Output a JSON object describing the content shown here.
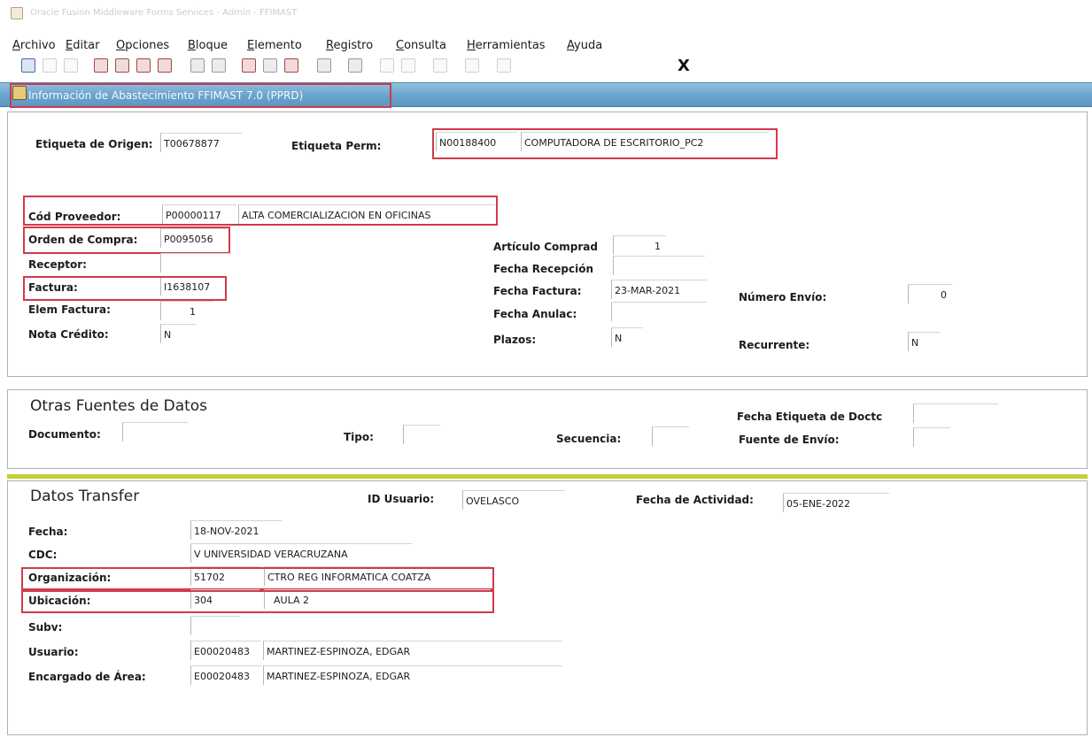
{
  "app_title": "Oracle Fusion Middleware Forms Services - Admin - FFIMAST",
  "menu": [
    "Archivo",
    "Editar",
    "Opciones",
    "Bloque",
    "Elemento",
    "Registro",
    "Consulta",
    "Herramientas",
    "Ayuda"
  ],
  "toolbar": {
    "exit_label": "X"
  },
  "header": {
    "title": "Información de Abastecimiento  FFIMAST  7.0  (PPRD)"
  },
  "main": {
    "etiqueta_origen": {
      "label": "Etiqueta de Origen:",
      "value": "T00678877"
    },
    "etiqueta_perm": {
      "label": "Etiqueta Perm:",
      "code": "N00188400",
      "desc": "COMPUTADORA DE ESCRITORIO_PC2"
    },
    "cod_proveedor": {
      "label": "Cód Proveedor:",
      "code": "P00000117",
      "desc": "ALTA COMERCIALIZACION EN OFICINAS"
    },
    "orden_compra": {
      "label": "Orden de Compra:",
      "value": "P0095056"
    },
    "receptor": {
      "label": "Receptor:",
      "value": ""
    },
    "factura": {
      "label": "Factura:",
      "value": "I1638107"
    },
    "elem_factura": {
      "label": "Elem Factura:",
      "value": "1"
    },
    "nota_credito": {
      "label": "Nota Crédito:",
      "value": "N"
    },
    "articulo_comprado": {
      "label": "Artículo Comprad",
      "value": "1"
    },
    "fecha_recepcion": {
      "label": "Fecha Recepción",
      "value": ""
    },
    "fecha_factura": {
      "label": "Fecha Factura:",
      "value": "23-MAR-2021"
    },
    "fecha_anulac": {
      "label": "Fecha Anulac:",
      "value": ""
    },
    "plazos": {
      "label": "Plazos:",
      "value": "N"
    },
    "numero_envio": {
      "label": "Número Envío:",
      "value": "0"
    },
    "recurrente": {
      "label": "Recurrente:",
      "value": "N"
    }
  },
  "otras": {
    "title": "Otras Fuentes de Datos",
    "documento": {
      "label": "Documento:",
      "value": ""
    },
    "tipo": {
      "label": "Tipo:",
      "value": ""
    },
    "secuencia": {
      "label": "Secuencia:",
      "value": ""
    },
    "fecha_etiqueta": {
      "label": "Fecha Etiqueta de Doctc",
      "value": ""
    },
    "fuente_envio": {
      "label": "Fuente de Envío:",
      "value": ""
    }
  },
  "transfer": {
    "title": "Datos Transfer",
    "id_usuario": {
      "label": "ID Usuario:",
      "value": "OVELASCO"
    },
    "fecha_actividad": {
      "label": "Fecha de Actividad:",
      "value": "05-ENE-2022"
    },
    "fecha": {
      "label": "Fecha:",
      "value": "18-NOV-2021"
    },
    "cdc": {
      "label": "CDC:",
      "value": "V  UNIVERSIDAD VERACRUZANA"
    },
    "organizacion": {
      "label": "Organización:",
      "code": "51702",
      "desc": "CTRO REG INFORMATICA COATZA"
    },
    "ubicacion": {
      "label": "Ubicación:",
      "code": "304",
      "desc": "AULA 2"
    },
    "subv": {
      "label": "Subv:",
      "value": ""
    },
    "usuario": {
      "label": "Usuario:",
      "code": "E00020483",
      "desc": "MARTINEZ-ESPINOZA, EDGAR"
    },
    "encargado": {
      "label": "Encargado de Área:",
      "code": "E00020483",
      "desc": "MARTINEZ-ESPINOZA, EDGAR"
    }
  },
  "colors": {
    "header_blue": "#6aa3cc",
    "highlight_red": "#d23a4a",
    "separator_yellow": "#c5cf3a"
  }
}
